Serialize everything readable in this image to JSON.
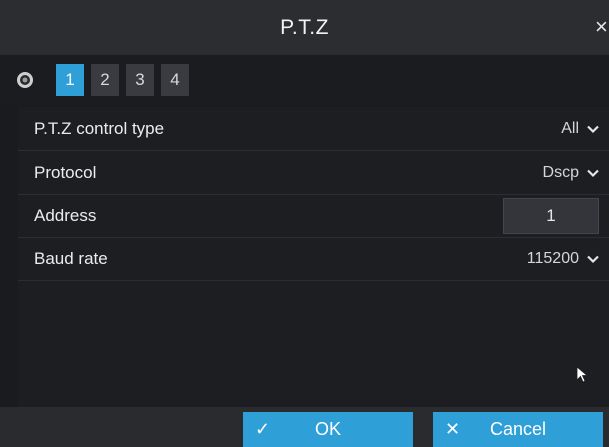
{
  "dialog": {
    "title": "P.T.Z",
    "close_glyph": "×"
  },
  "channels": {
    "icon": "camera-icon",
    "tabs": [
      "1",
      "2",
      "3",
      "4"
    ],
    "selected": "1"
  },
  "settings": {
    "control_type": {
      "label": "P.T.Z control type",
      "value": "All"
    },
    "protocol": {
      "label": "Protocol",
      "value": "Dscp"
    },
    "address": {
      "label": "Address",
      "value": "1"
    },
    "baud_rate": {
      "label": "Baud rate",
      "value": "115200"
    }
  },
  "buttons": {
    "ok": {
      "label": "OK",
      "icon": "check-icon",
      "glyph": "✓"
    },
    "cancel": {
      "label": "Cancel",
      "icon": "close-icon",
      "glyph": "✕"
    }
  },
  "colors": {
    "accent": "#2f9fd8",
    "background": "#1a1b1f",
    "titlebar": "#2c2d31"
  }
}
